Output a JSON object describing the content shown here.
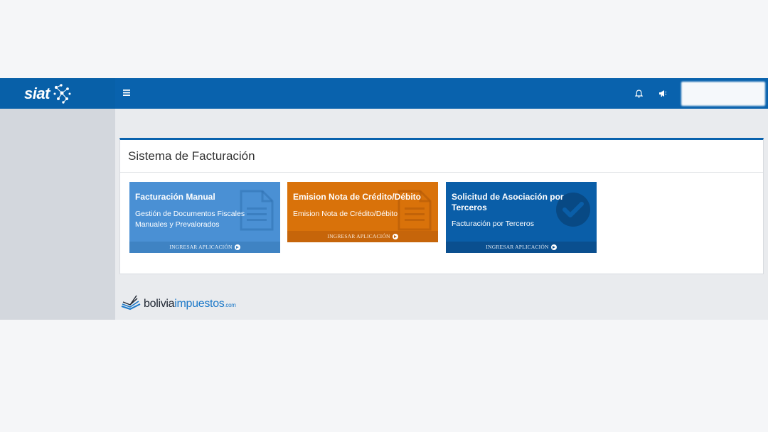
{
  "brand": {
    "name": "siat"
  },
  "header": {
    "menu_icon": "hamburger-menu-icon",
    "notifications_icon": "bell-icon",
    "announcements_icon": "megaphone-icon"
  },
  "panel": {
    "title": "Sistema de Facturación"
  },
  "tiles": [
    {
      "title": "Facturación Manual",
      "subtitle": "Gestión de Documentos Fiscales Manuales y Prevalorados",
      "action": "INGRESAR APLICACIÓN",
      "icon": "document-icon",
      "color": "#4a90d4"
    },
    {
      "title": "Emision Nota de Crédito/Débito",
      "subtitle": "Emision Nota de Crédito/Débito",
      "action": "INGRESAR APLICACIÓN",
      "icon": "document-icon",
      "color": "#d9720a"
    },
    {
      "title": "Solicitud de Asociación por Terceros",
      "subtitle": "Facturación por Terceros",
      "action": "INGRESAR APLICACIÓN",
      "icon": "check-circle-icon",
      "color": "#0a5ea8"
    }
  ],
  "footer": {
    "logo_part1": "bolivia",
    "logo_part2": "impuestos",
    "logo_part3": ".com"
  }
}
